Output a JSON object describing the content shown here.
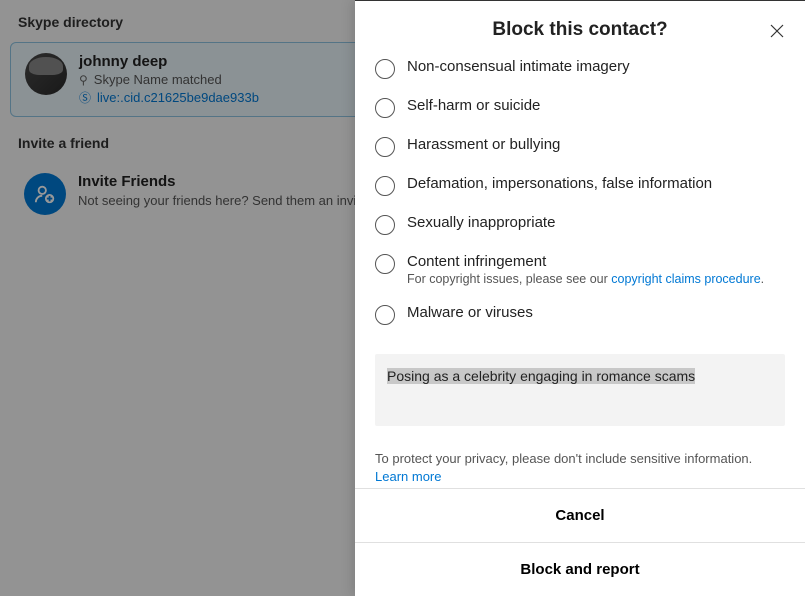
{
  "directory": {
    "header": "Skype directory",
    "contact": {
      "name": "johnny deep",
      "matched_label": "Skype Name matched",
      "live_id": "live:.cid.c21625be9dae933b"
    }
  },
  "invite": {
    "header": "Invite a friend",
    "title": "Invite Friends",
    "subtext": "Not seeing your friends here? Send them an invite to join Skype!"
  },
  "modal": {
    "title": "Block this contact?",
    "options": [
      {
        "label": "Non-consensual intimate imagery"
      },
      {
        "label": "Self-harm or suicide"
      },
      {
        "label": "Harassment or bullying"
      },
      {
        "label": "Defamation, impersonations, false information"
      },
      {
        "label": "Sexually inappropriate"
      },
      {
        "label": "Content infringement",
        "subtext_prefix": "For copyright issues, please see our ",
        "subtext_link": "copyright claims procedure"
      },
      {
        "label": "Malware or viruses"
      }
    ],
    "textarea_value": "Posing as a celebrity engaging in romance scams",
    "privacy_prefix": "To protect your privacy, please don't include sensitive information. ",
    "privacy_link": "Learn more",
    "cancel_label": "Cancel",
    "block_label": "Block and report"
  }
}
